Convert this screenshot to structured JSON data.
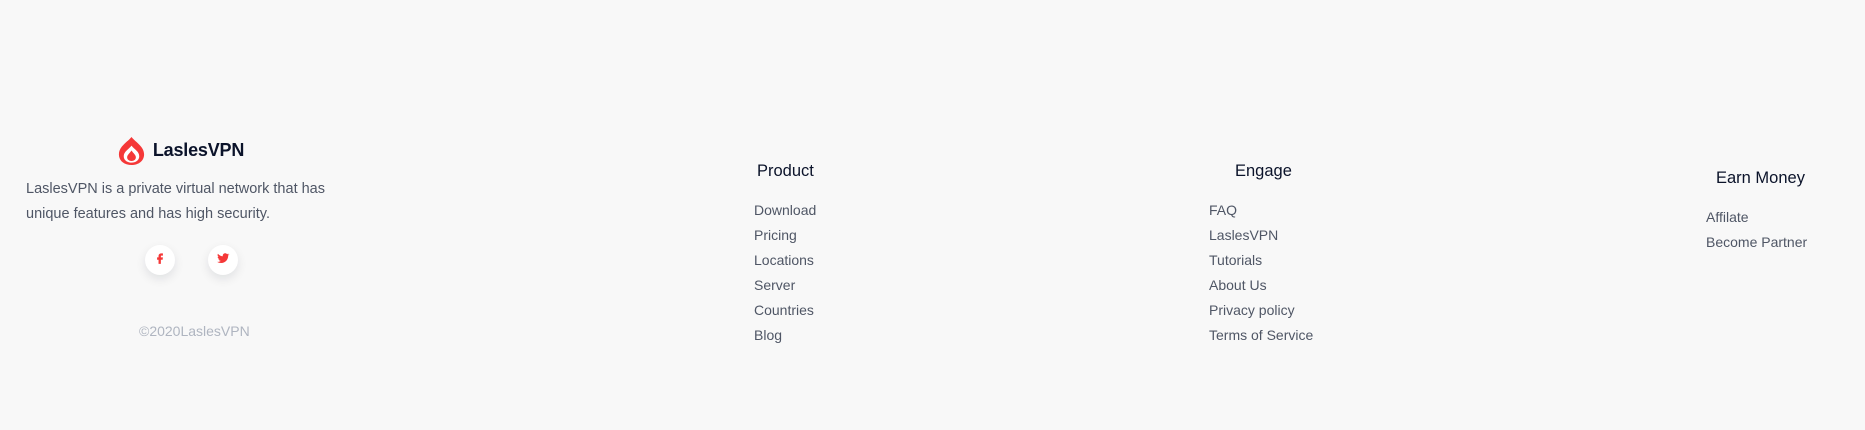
{
  "brand": {
    "name": "LaslesVPN",
    "logo_icon": "flame-logo-icon",
    "accent_color": "#f53838",
    "description": "LaslesVPN is a private virtual network that has unique features and has high security.",
    "socials": [
      {
        "icon": "facebook-icon",
        "glyph": "f"
      },
      {
        "icon": "twitter-icon"
      }
    ],
    "copyright": "©2020LaslesVPN"
  },
  "columns": {
    "product": {
      "title": "Product",
      "links": [
        "Download",
        "Pricing",
        "Locations",
        "Server",
        "Countries",
        "Blog"
      ]
    },
    "engage": {
      "title": "Engage",
      "links": [
        "FAQ",
        "LaslesVPN",
        "Tutorials",
        "About Us",
        "Privacy policy",
        "Terms of Service"
      ]
    },
    "earn": {
      "title": "Earn Money",
      "links": [
        "Affilate",
        "Become Partner"
      ]
    }
  }
}
